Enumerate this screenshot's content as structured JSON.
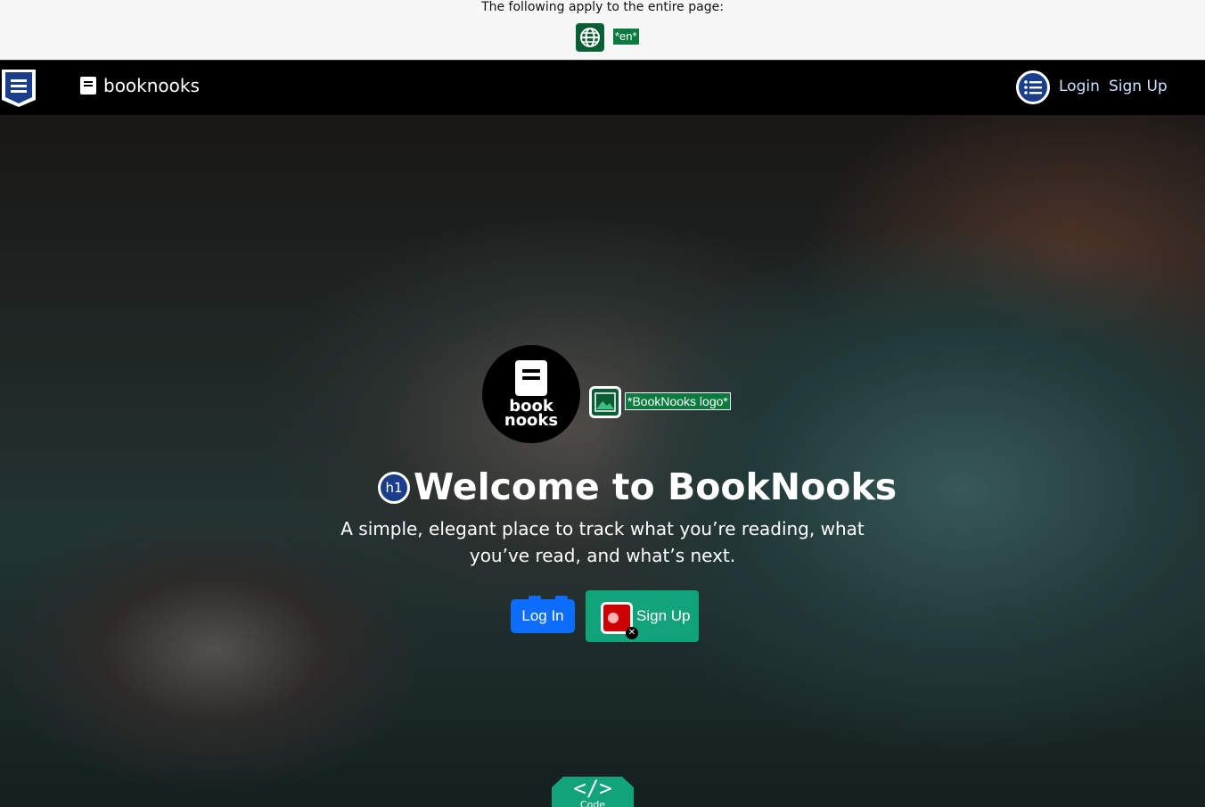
{
  "a11y_overlay": {
    "title": "The following apply to the entire page:",
    "language_tag": "*en*",
    "language_icon": "globe-icon"
  },
  "navbar": {
    "landmark_icon": "list-landmark-icon",
    "brand_icon": "book-icon",
    "brand": "booknooks",
    "list_icon": "list-icon",
    "links": {
      "login": "Login",
      "signup": "Sign Up"
    }
  },
  "hero": {
    "logo_line1": "book",
    "logo_line2": "nooks",
    "image_alt_tag": "*BookNooks logo*",
    "h1_badge": "h1",
    "title": "Welcome to BookNooks",
    "subtitle": "A simple, elegant place to track what you’re reading, what you’ve read, and what’s next.",
    "login_button": "Log In",
    "signup_button": "Sign Up",
    "code_tab_label": "Code",
    "code_glyph": "</>"
  },
  "colors": {
    "primary_blue": "#0d6efd",
    "accent_green": "#12a37a",
    "overlay_green": "#0b7a3e",
    "badge_blue": "#1a3e8c"
  }
}
